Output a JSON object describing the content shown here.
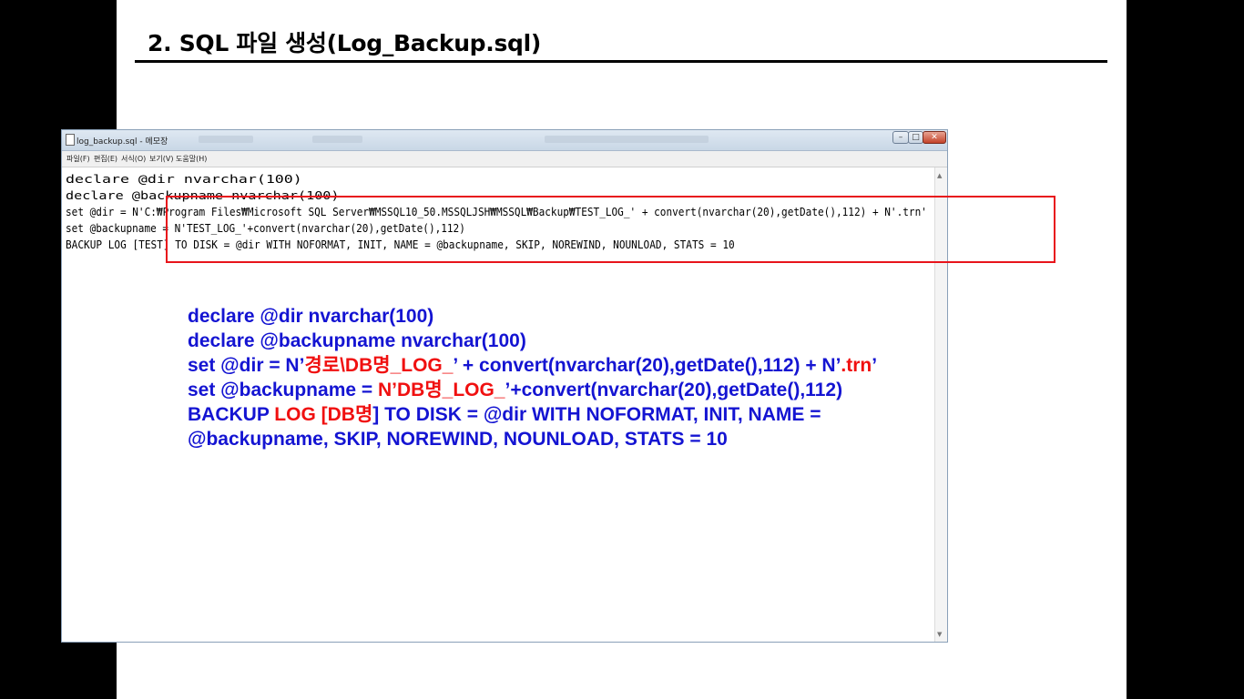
{
  "slide": {
    "title": "2. SQL 파일 생성(Log_Backup.sql)"
  },
  "notepad": {
    "window_title": "log_backup.sql - 메모장",
    "menu": [
      "파일(F)",
      "편집(E)",
      "서식(O)",
      "보기(V)",
      "도움말(H)"
    ],
    "lines": [
      "declare @dir nvarchar(100)",
      "declare @backupname nvarchar(100)",
      "set @dir = N'C:₩Program Files₩Microsoft SQL Server₩MSSQL10_50.MSSQLJSH₩MSSQL₩Backup₩TEST_LOG_' + convert(nvarchar(20),getDate(),112) + N'.trn'",
      "set @backupname = N'TEST_LOG_'+convert(nvarchar(20),getDate(),112)",
      "BACKUP LOG [TEST] TO DISK = @dir WITH NOFORMAT, INIT, NAME = @backupname, SKIP, NOREWIND, NOUNLOAD, STATS = 10"
    ]
  },
  "explanation": {
    "line1": "declare @dir nvarchar(100)",
    "line2": "declare @backupname nvarchar(100)",
    "line3": {
      "a": "set @dir = N’",
      "b": "경로\\DB명_LOG_",
      "c": "’ + convert(nvarchar(20),getDate(),112) + N’",
      "d": ".trn",
      "e": "’"
    },
    "line4": {
      "a": "set @backupname = ",
      "b": "N’DB명_LOG_",
      "c": "’+convert(nvarchar(20),getDate(),112)"
    },
    "line5": {
      "a": "BACKUP ",
      "b": "LOG [DB명",
      "c": "] TO DISK = @dir WITH NOFORMAT, INIT, NAME ="
    },
    "line6": "@backupname, SKIP, NOREWIND, NOUNLOAD, STATS = 10"
  },
  "colors": {
    "highlight_box": "#e8141b",
    "explanation_blue": "#1414d2",
    "explanation_red": "#f01010"
  }
}
